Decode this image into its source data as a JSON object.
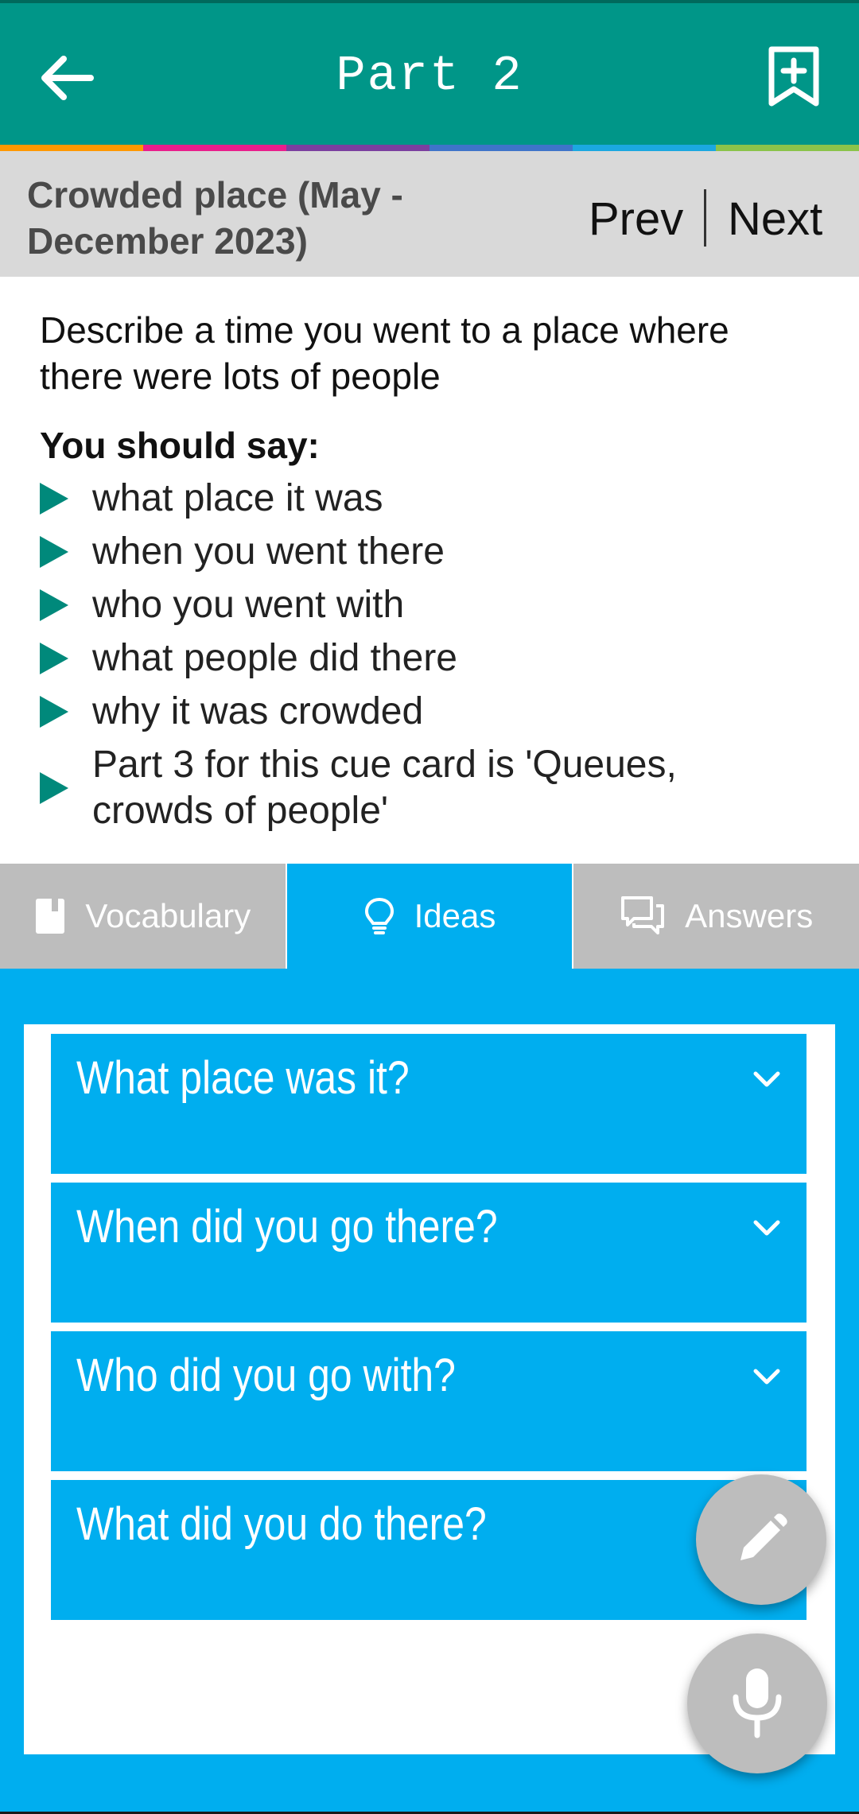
{
  "appbar": {
    "title": "Part 2",
    "back_icon": "arrow-left-icon",
    "bookmark_icon": "bookmark-add-icon",
    "color": "#009688"
  },
  "stripe_colors": [
    "#ff9800",
    "#e91e8c",
    "#7b3fa0",
    "#3f74c9",
    "#1ba8e0",
    "#8bc34a"
  ],
  "topic": {
    "title": "Crowded place (May - December 2023)",
    "prev_label": "Prev",
    "next_label": "Next"
  },
  "cue_card": {
    "prompt": "Describe a time you went to a place where there were lots of people",
    "should_say_label": "You should say:",
    "points": [
      "what place it was",
      "when you went there",
      "who you went with",
      "what people did there",
      "why it was crowded",
      "Part 3 for this cue card is 'Queues, crowds of people'"
    ]
  },
  "tabs": [
    {
      "label": "Vocabulary",
      "icon": "book-icon",
      "active": false
    },
    {
      "label": "Ideas",
      "icon": "lightbulb-icon",
      "active": true
    },
    {
      "label": "Answers",
      "icon": "chat-bubbles-icon",
      "active": false
    }
  ],
  "ideas": [
    {
      "question": "What place was it?"
    },
    {
      "question": "When did you go there?"
    },
    {
      "question": "Who did you go with?"
    },
    {
      "question": "What did you do there?"
    }
  ],
  "fabs": {
    "edit_icon": "pencil-icon",
    "mic_icon": "microphone-icon"
  },
  "accent": "#00aeef"
}
